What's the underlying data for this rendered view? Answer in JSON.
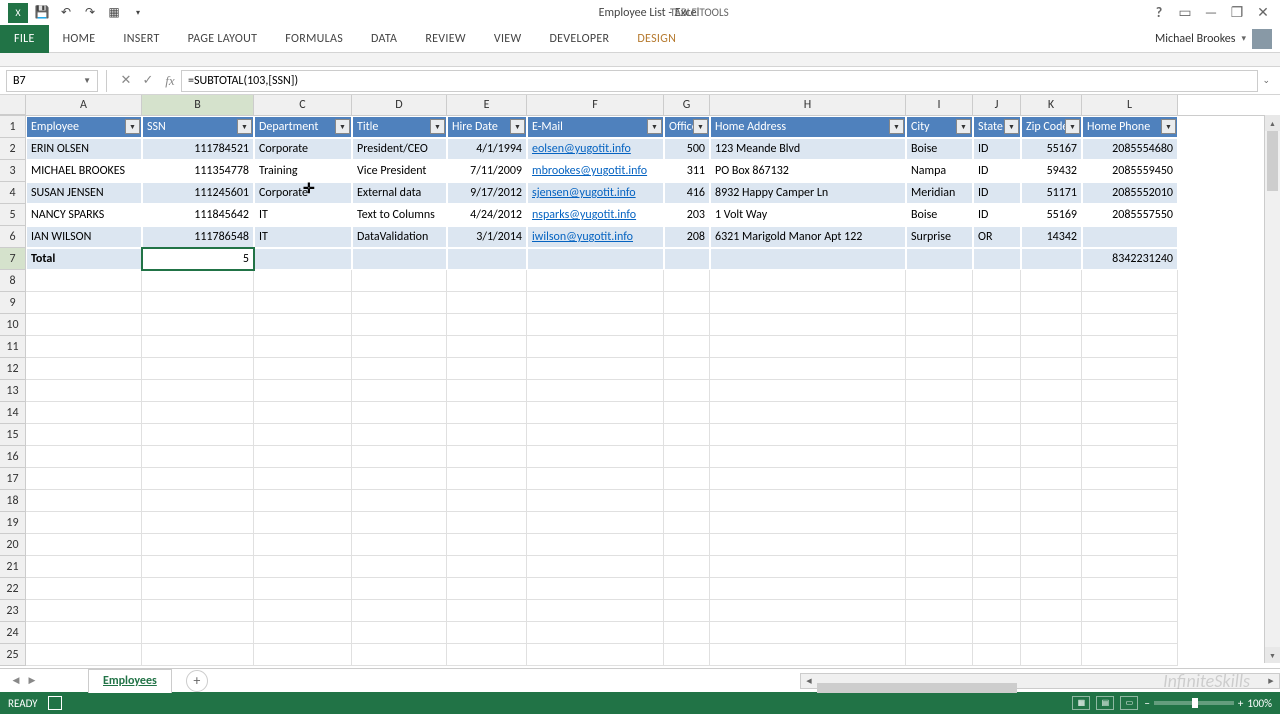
{
  "app": {
    "title": "Employee List - Excel",
    "table_tools": "TABLE TOOLS",
    "user_name": "Michael Brookes"
  },
  "ribbon": {
    "tabs": [
      "FILE",
      "HOME",
      "INSERT",
      "PAGE LAYOUT",
      "FORMULAS",
      "DATA",
      "REVIEW",
      "VIEW",
      "DEVELOPER",
      "DESIGN"
    ]
  },
  "formula_bar": {
    "name_box": "B7",
    "formula": "=SUBTOTAL(103,[SSN])"
  },
  "columns": {
    "letters": [
      "A",
      "B",
      "C",
      "D",
      "E",
      "F",
      "G",
      "H",
      "I",
      "J",
      "K",
      "L"
    ],
    "widths": [
      116,
      112,
      98,
      95,
      80,
      137,
      46,
      196,
      67,
      48,
      61,
      96
    ],
    "headers": [
      "Employee",
      "SSN",
      "Department",
      "Title",
      "Hire Date",
      "E-Mail",
      "Office",
      "Home Address",
      "City",
      "State",
      "Zip Code",
      "Home Phone"
    ]
  },
  "rows": [
    {
      "n": 2,
      "cells": [
        "ERIN OLSEN",
        "111784521",
        "Corporate",
        "President/CEO",
        "4/1/1994",
        "eolsen@yugotit.info",
        "500",
        "123 Meande Blvd",
        "Boise",
        "ID",
        "55167",
        "2085554680"
      ]
    },
    {
      "n": 3,
      "cells": [
        "MICHAEL BROOKES",
        "111354778",
        "Training",
        "Vice President",
        "7/11/2009",
        "mbrookes@yugotit.info",
        "311",
        "PO Box 867132",
        "Nampa",
        "ID",
        "59432",
        "2085559450"
      ]
    },
    {
      "n": 4,
      "cells": [
        "SUSAN JENSEN",
        "111245601",
        "Corporate",
        "External data",
        "9/17/2012",
        "sjensen@yugotit.info",
        "416",
        "8932 Happy Camper Ln",
        "Meridian",
        "ID",
        "51171",
        "2085552010"
      ]
    },
    {
      "n": 5,
      "cells": [
        "NANCY SPARKS",
        "111845642",
        "IT",
        "Text to Columns",
        "4/24/2012",
        "nsparks@yugotit.info",
        "203",
        "1 Volt Way",
        "Boise",
        "ID",
        "55169",
        "2085557550"
      ]
    },
    {
      "n": 6,
      "cells": [
        "IAN WILSON",
        "111786548",
        "IT",
        "DataValidation",
        "3/1/2014",
        "iwilson@yugotit.info",
        "208",
        "6321 Marigold Manor Apt 122",
        "Surprise",
        "OR",
        "14342",
        ""
      ]
    }
  ],
  "total_row": {
    "label": "Total",
    "ssn_count": "5",
    "last": "8342231240"
  },
  "sheet": {
    "active_tab": "Employees"
  },
  "status": {
    "ready": "READY",
    "zoom": "100%"
  },
  "selected_cell": "B7"
}
